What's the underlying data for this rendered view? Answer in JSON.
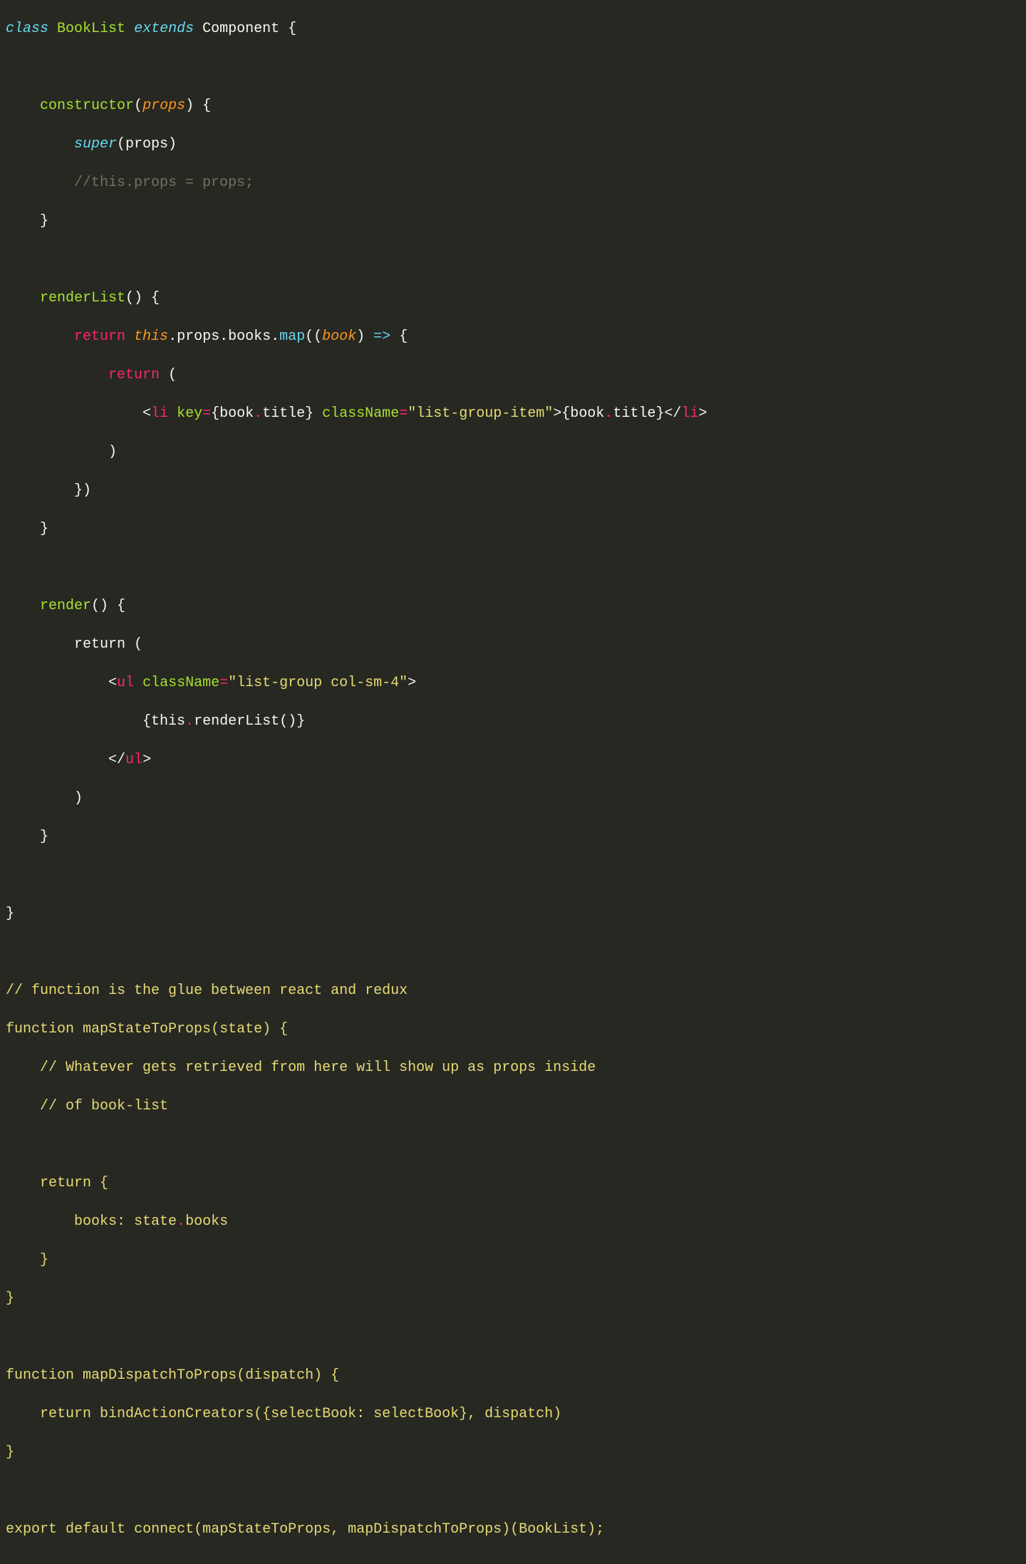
{
  "lines": {
    "l1_class": "class",
    "l1_name": "BookList",
    "l1_extends": "extends",
    "l1_component": "Component",
    "l1_brace": " {",
    "l2": "",
    "l3_ctor": "constructor",
    "l3_paren_open": "(",
    "l3_props": "props",
    "l3_paren_close": ")",
    "l3_brace": " {",
    "l4_super": "super",
    "l4_args": "(props)",
    "l5_comment": "//this.props = props;",
    "l6_close": "}",
    "l7": "",
    "l8_fn": "renderList",
    "l8_rest": "() {",
    "l9_return": "return",
    "l9_this": "this",
    "l9_props": ".props",
    "l9_books": ".books",
    "l9_map": ".map",
    "l9_paren": "((",
    "l9_book": "book",
    "l9_close": ")",
    "l9_arrow": " => ",
    "l9_brace": "{",
    "l10_return": "return",
    "l10_paren": " (",
    "l11_open": "<",
    "l11_li": "li",
    "l11_key": "key",
    "l11_eq": "=",
    "l11_b1": "{book",
    "l11_dot1": ".",
    "l11_title1": "title}",
    "l11_cn": "className",
    "l11_eq2": "=",
    "l11_str": "\"list-group-item\"",
    "l11_gt": ">",
    "l11_b2": "{book",
    "l11_dot2": ".",
    "l11_title2": "title}",
    "l11_close": "</",
    "l11_li2": "li",
    "l11_gt2": ">",
    "l12_paren": ")",
    "l13_close": "})",
    "l14_close": "}",
    "l15": "",
    "l16_fn": "render",
    "l16_rest": "() {",
    "l17_return": "return (",
    "l18_open": "<",
    "l18_ul": "ul",
    "l18_cn": "className",
    "l18_eq": "=",
    "l18_str": "\"list-group col-sm-4\"",
    "l18_gt": ">",
    "l19_expr": "{this",
    "l19_dot": ".",
    "l19_call": "renderList()}",
    "l20_close": "</",
    "l20_ul": "ul",
    "l20_gt": ">",
    "l21_paren": ")",
    "l22_close": "}",
    "l23": "",
    "l24_close": "}",
    "l25": "",
    "l26_comment": "// function is the glue between react and redux",
    "l27_fn": "function",
    "l27_name": "mapStateToProps",
    "l27_args": "(state) {",
    "l28_comment": "// Whatever gets retrieved from here will show up as props inside",
    "l29_comment": "// of book-list",
    "l30": "",
    "l31_return": "return {",
    "l32_books": "books: state",
    "l32_dot": ".",
    "l32_books2": "books",
    "l33_close": "}",
    "l34_close": "}",
    "l35": "",
    "l36_fn": "function",
    "l36_name": "mapDispatchToProps",
    "l36_args": "(dispatch) {",
    "l37_return": "return",
    "l37_bind": "bindActionCreators",
    "l37_args": "({selectBook: selectBook}, dispatch)",
    "l38_close": "}",
    "l39": "",
    "l40_export": "export",
    "l40_default": "default",
    "l40_connect": "connect",
    "l40_args": "(mapStateToProps, mapDispatchToProps)(BookList);"
  }
}
